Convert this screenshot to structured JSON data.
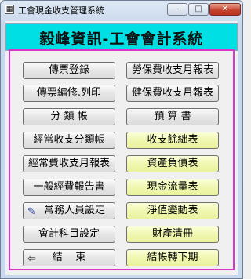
{
  "window": {
    "title": "工會現金收支管理系統",
    "icon": "app-icon",
    "controls": {
      "minimize": "–",
      "maximize": "□",
      "close": "✕"
    }
  },
  "banner": {
    "text": "毅峰資訊-工會會計系統"
  },
  "left_buttons": [
    {
      "label": "傳票登錄"
    },
    {
      "label": "傳票編修.列印"
    },
    {
      "label": "分 類 帳"
    },
    {
      "label": "經常收支分類帳"
    },
    {
      "label": "經常費收支月報表"
    },
    {
      "label": "一般經費報告書"
    },
    {
      "label": "常務人員設定",
      "icon": "pencil-icon"
    },
    {
      "label": "會計科目設定"
    },
    {
      "label": "結    束",
      "icon": "exit-icon"
    }
  ],
  "right_buttons": [
    {
      "label": "勞保費收支月報表",
      "style": "gray"
    },
    {
      "label": "健保費收支月報表",
      "style": "gray"
    },
    {
      "label": "預 算 書",
      "style": "gray"
    },
    {
      "label": "收支餘絀表",
      "style": "yellow"
    },
    {
      "label": "資產負債表",
      "style": "yellow"
    },
    {
      "label": "現金流量表",
      "style": "yellow"
    },
    {
      "label": "淨值變動表",
      "style": "yellow"
    },
    {
      "label": "財產清冊",
      "style": "yellow"
    },
    {
      "label": "結帳轉下期",
      "style": "yellow"
    }
  ],
  "colors": {
    "banner": "#00e0e4",
    "panel_border": "#d936c9",
    "yellow_button": "#f0f7b0"
  }
}
